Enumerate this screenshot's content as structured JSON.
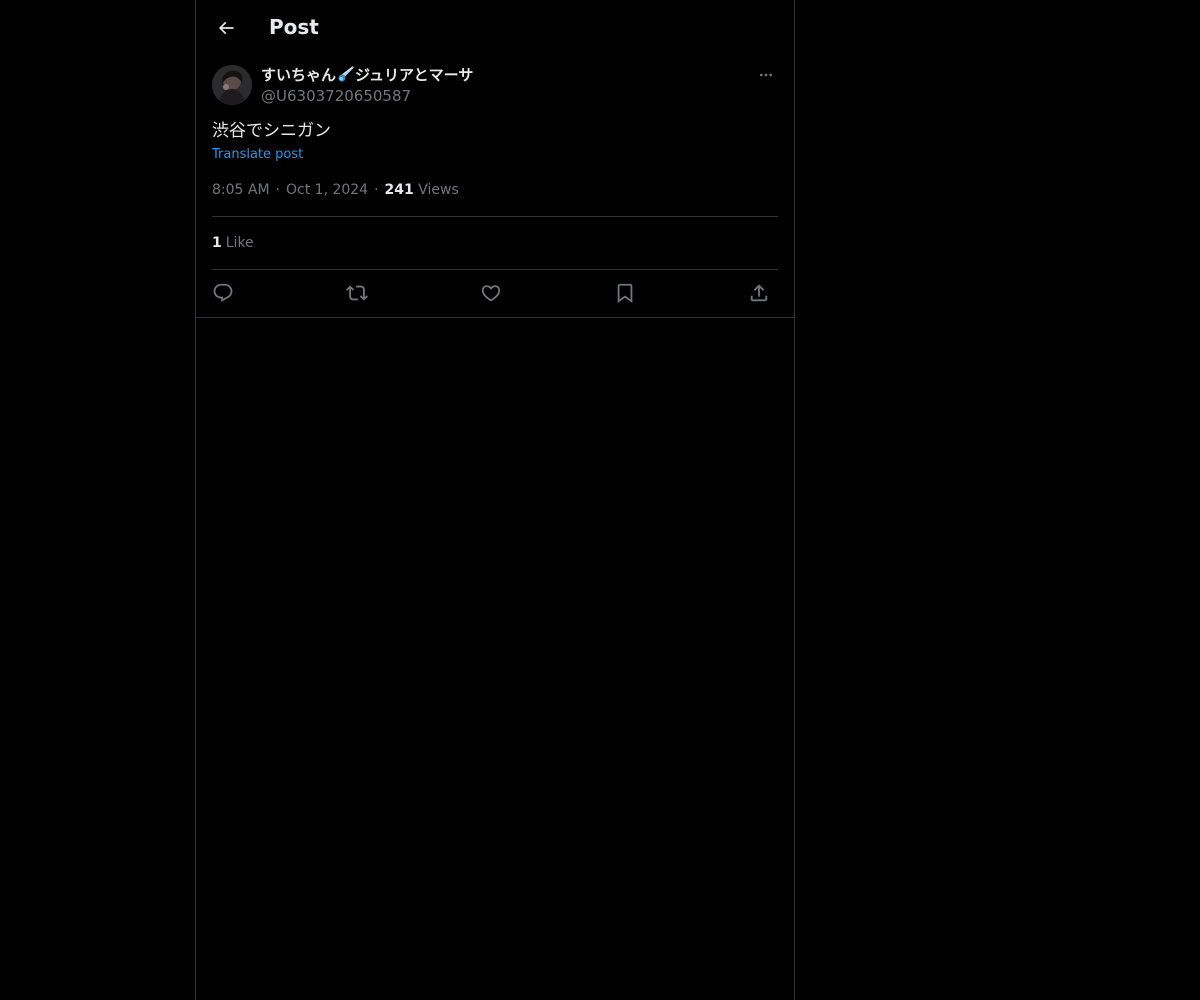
{
  "header": {
    "title": "Post",
    "back_icon": "arrow-left-icon"
  },
  "author": {
    "display_name_prefix": "すいちゃん",
    "display_name_emoji": "comet-icon",
    "display_name_suffix": "ジュリアとマーサ",
    "handle": "@U6303720650587",
    "more_icon": "more-horizontal-icon"
  },
  "post": {
    "text": "渋谷でシニガン",
    "translate_label": "Translate post",
    "time": "8:05 AM",
    "date": "Oct 1, 2024",
    "separator": "·",
    "views_count": "241",
    "views_label": "Views"
  },
  "stats": {
    "likes_count": "1",
    "likes_label": "Like"
  },
  "actions": [
    {
      "name": "reply",
      "icon": "reply-icon"
    },
    {
      "name": "repost",
      "icon": "repost-icon"
    },
    {
      "name": "like",
      "icon": "heart-icon"
    },
    {
      "name": "bookmark",
      "icon": "bookmark-icon"
    },
    {
      "name": "share",
      "icon": "share-icon"
    }
  ],
  "colors": {
    "background": "#000000",
    "text_primary": "#e7e9ea",
    "text_secondary": "#71767b",
    "link": "#1d9bf0",
    "border": "#2f3336"
  }
}
